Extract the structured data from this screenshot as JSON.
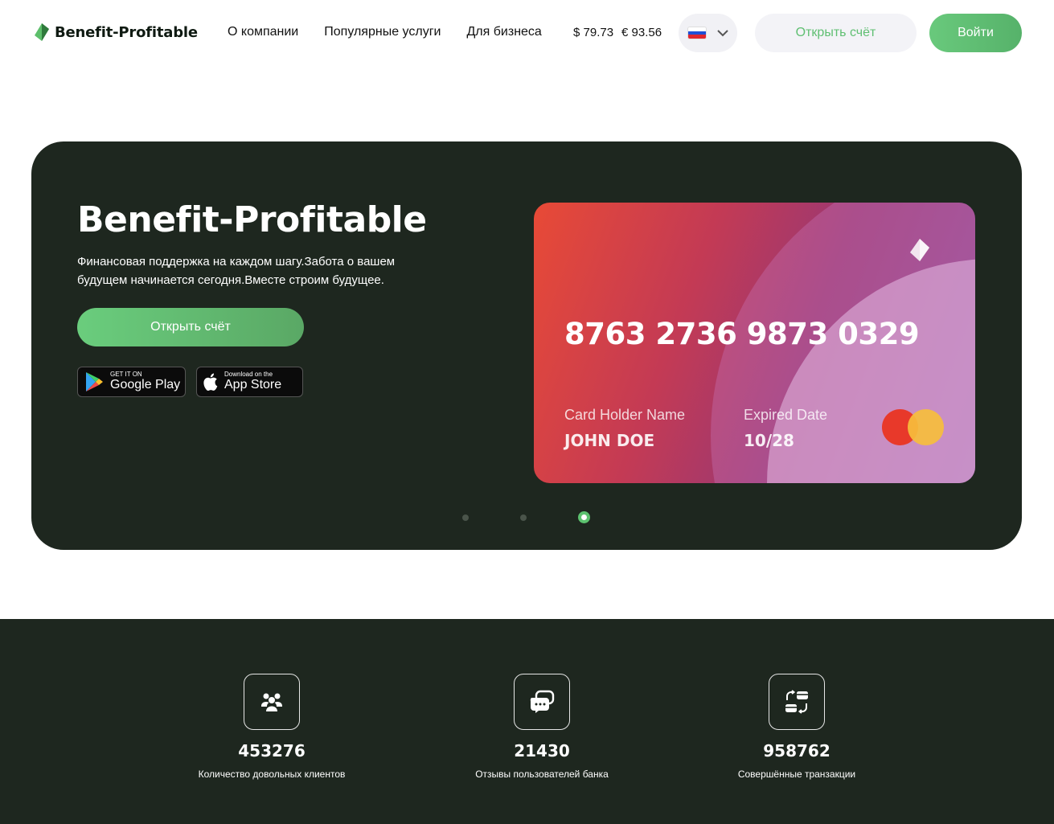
{
  "header": {
    "logo_text": "Benefit-Profitable",
    "nav": [
      {
        "label": "О компании"
      },
      {
        "label": "Популярные услуги"
      },
      {
        "label": "Для бизнеса"
      }
    ],
    "rates": {
      "usd": "$ 79.73",
      "eur": "€ 93.56"
    },
    "language": {
      "flag": "ru-flag",
      "icon": "chevron-down-icon"
    },
    "open_account_label": "Открыть счёт",
    "login_label": "Войти"
  },
  "hero": {
    "title": "Benefit-Profitable",
    "subtitle": "Финансовая поддержка на каждом шагу.Забота о вашем будущем начинается сегодня.Вместе строим будущее.",
    "cta_label": "Открыть счёт",
    "google_play": {
      "small": "GET IT ON",
      "big": "Google Play"
    },
    "app_store": {
      "small": "Download on the",
      "big": "App Store"
    },
    "card": {
      "number": "8763 2736 9873 0329",
      "holder_label": "Card Holder Name",
      "holder_value": "JOHN DOE",
      "expiry_label": "Expired Date",
      "expiry_value": "10/28"
    },
    "carousel": {
      "slides": 3,
      "active": 3
    }
  },
  "stats": [
    {
      "icon": "users-icon",
      "value": "453276",
      "label": "Количество довольных клиентов"
    },
    {
      "icon": "chat-icon",
      "value": "21430",
      "label": "Отзывы пользователей банка"
    },
    {
      "icon": "transactions-icon",
      "value": "958762",
      "label": "Совершённые транзакции"
    }
  ],
  "colors": {
    "accent": "#5cc26f",
    "dark": "#1e271f"
  }
}
